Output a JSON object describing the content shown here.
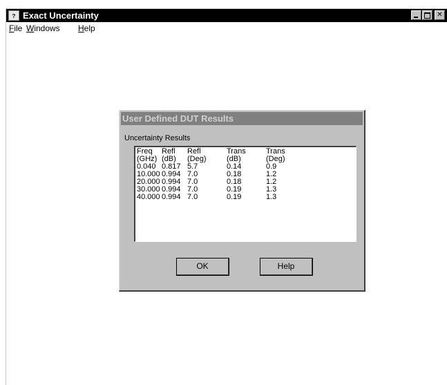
{
  "window": {
    "title": "Exact Uncertainty",
    "icon": "app-icon",
    "controls": [
      "minimize-icon",
      "maximize-icon",
      "close-icon"
    ]
  },
  "menu": {
    "items": [
      {
        "label": "File",
        "accel": "F"
      },
      {
        "label": "Windows",
        "accel": "W"
      },
      {
        "label": "Help",
        "accel": "H"
      }
    ]
  },
  "dialog": {
    "title": "User Defined DUT Results",
    "group_label": "Uncertainty Results",
    "table": {
      "headers": [
        [
          "Freq",
          "(GHz)"
        ],
        [
          "Refl",
          "(dB)"
        ],
        [
          "Refl",
          "(Deg)"
        ],
        [
          "Trans",
          "(dB)"
        ],
        [
          "Trans",
          "(Deg)"
        ]
      ],
      "rows": [
        [
          "0.040",
          "0.817",
          "5.7",
          "0.14",
          "0.9"
        ],
        [
          "10.000",
          "0.994",
          "7.0",
          "0.18",
          "1.2"
        ],
        [
          "20.000",
          "0.994",
          "7.0",
          "0.18",
          "1.2"
        ],
        [
          "30.000",
          "0.994",
          "7.0",
          "0.19",
          "1.3"
        ],
        [
          "40.000",
          "0.994",
          "7.0",
          "0.19",
          "1.3"
        ]
      ]
    },
    "buttons": {
      "ok": "OK",
      "help": "Help"
    }
  }
}
